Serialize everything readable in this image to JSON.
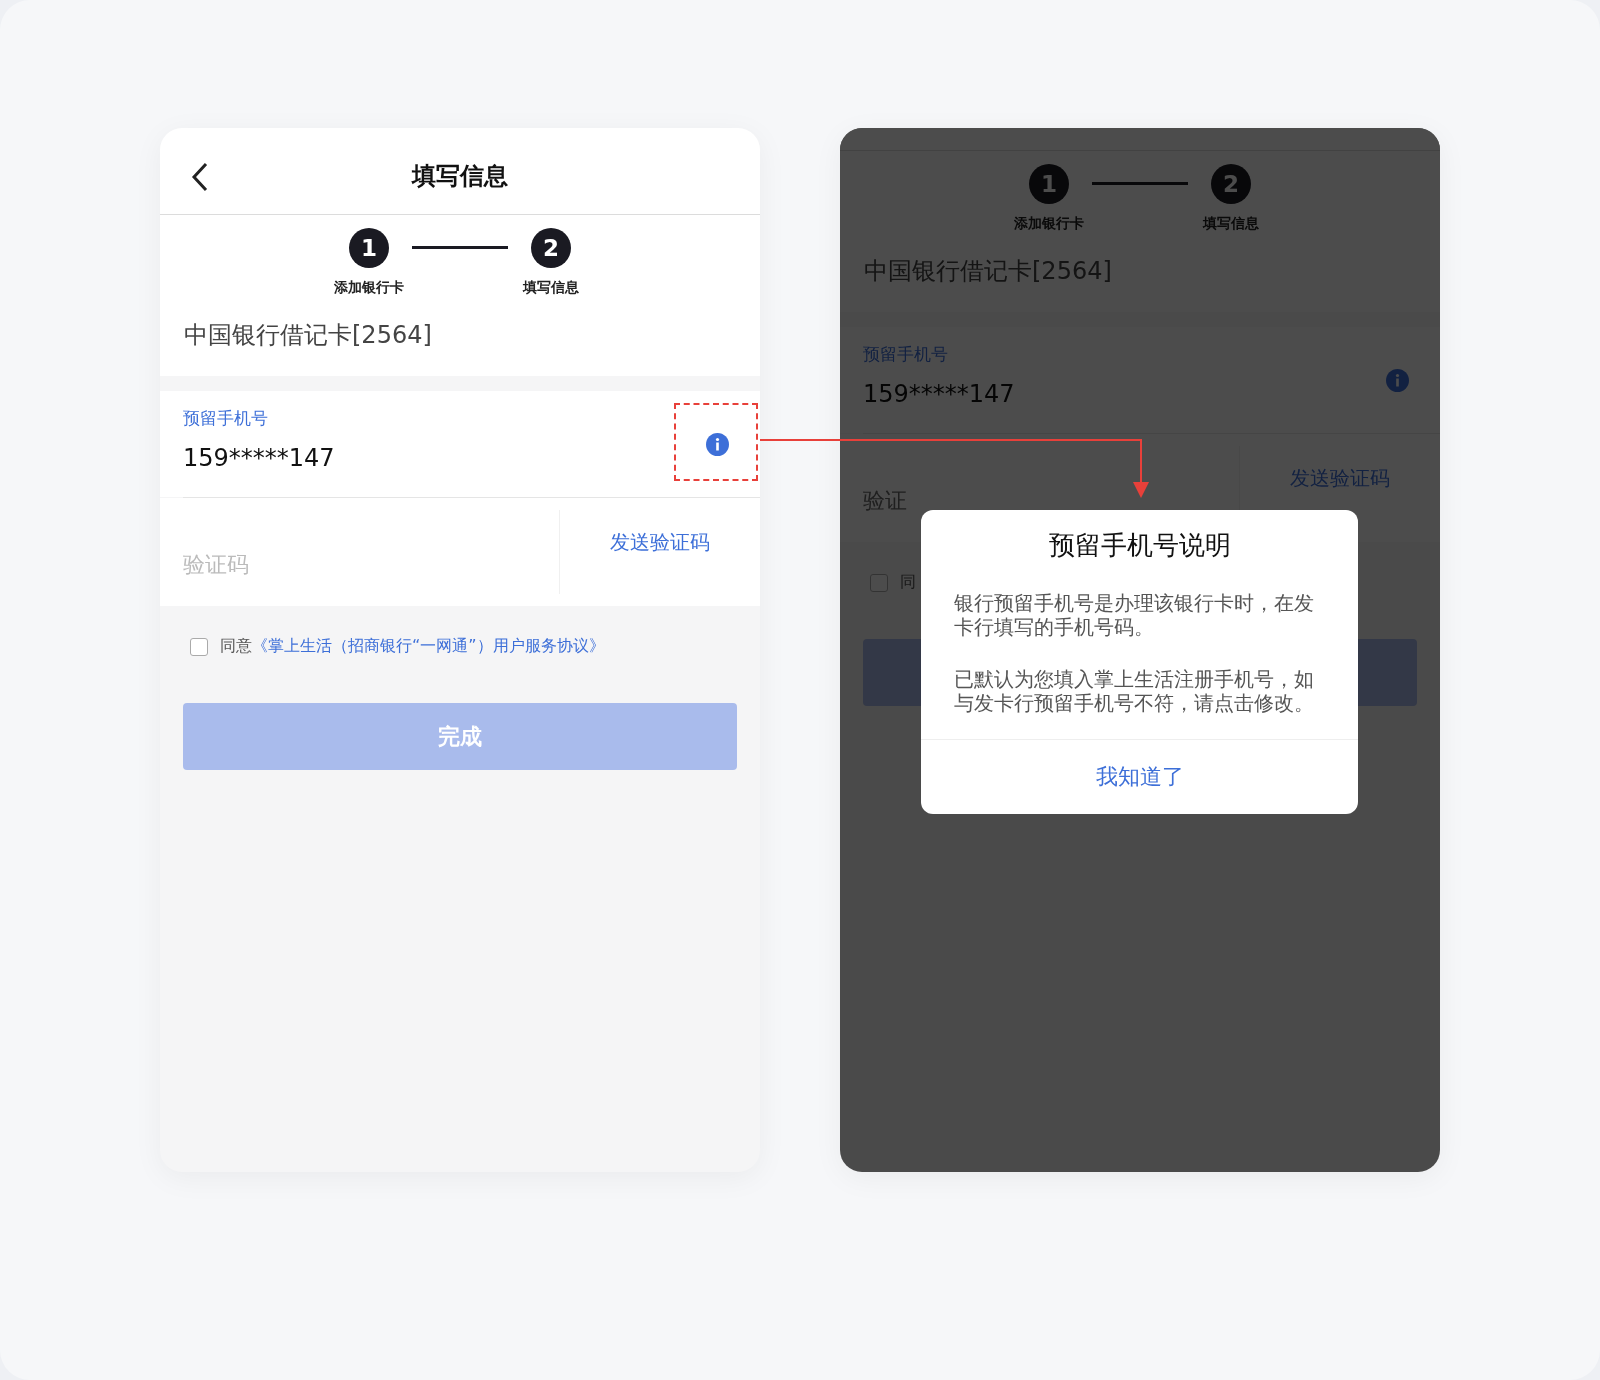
{
  "screens": [
    {
      "dimmed": false,
      "header": {
        "title": "填写信息"
      },
      "steps": [
        {
          "number": "1",
          "label": "添加银行卡"
        },
        {
          "number": "2",
          "label": "填写信息"
        }
      ],
      "card_name": "中国银行借记卡[2564]",
      "phone_field": {
        "label": "预留手机号",
        "value": "159*****147",
        "annotated": true
      },
      "code_field": {
        "placeholder": "验证码",
        "action": "发送验证码"
      },
      "agreement": {
        "checked": false,
        "prefix": "同意",
        "link": "《掌上生活（招商银行“一网通”）用户服务协议》"
      },
      "submit": {
        "label": "完成",
        "disabled": true
      }
    },
    {
      "dimmed": true,
      "steps": [
        {
          "number": "1",
          "label": "添加银行卡"
        },
        {
          "number": "2",
          "label": "填写信息"
        }
      ],
      "card_name": "中国银行借记卡[2564]",
      "phone_field": {
        "label": "预留手机号",
        "value": "159*****147"
      },
      "code_field": {
        "placeholder": "验证",
        "action": "发送验证码"
      },
      "agreement": {
        "checked": false,
        "prefix": "同"
      },
      "submit": {
        "disabled": true
      },
      "dialog": {
        "title": "预留手机号说明",
        "paragraphs": [
          "银行预留手机号是办理该银行卡时，在发卡行填写的手机号码。",
          "已默认为您填入掌上生活注册手机号，如与发卡行预留手机号不符，请点击修改。"
        ],
        "button": "我知道了"
      }
    }
  ]
}
